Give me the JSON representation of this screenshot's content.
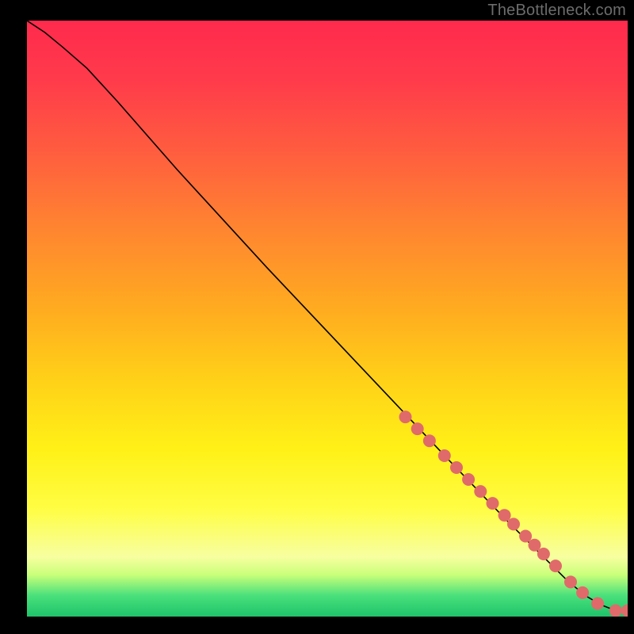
{
  "attribution": "TheBottleneck.com",
  "chart_data": {
    "type": "line",
    "title": "",
    "xlabel": "",
    "ylabel": "",
    "xlim": [
      0,
      100
    ],
    "ylim": [
      0,
      100
    ],
    "background_gradient": {
      "type": "vertical",
      "stops": [
        {
          "pos": 0.0,
          "color": "#ff2a4d"
        },
        {
          "pos": 0.5,
          "color": "#ffbf1a"
        },
        {
          "pos": 0.8,
          "color": "#fffb30"
        },
        {
          "pos": 0.96,
          "color": "#49e07c"
        },
        {
          "pos": 1.0,
          "color": "#1fc36a"
        }
      ]
    },
    "series": [
      {
        "name": "curve",
        "style": "line",
        "color": "#000000",
        "width": 1.6,
        "x": [
          0.0,
          3.0,
          6.0,
          10.0,
          15.0,
          25.0,
          40.0,
          55.0,
          70.0,
          80.0,
          86.0,
          90.0,
          93.0,
          95.5,
          97.0,
          98.5,
          100.0
        ],
        "y": [
          100.0,
          98.0,
          95.5,
          92.0,
          86.5,
          75.0,
          58.5,
          42.5,
          26.5,
          16.0,
          10.0,
          6.0,
          3.5,
          2.0,
          1.4,
          1.0,
          1.0
        ]
      },
      {
        "name": "points",
        "style": "marker",
        "color": "#e06a6a",
        "radius": 8,
        "x": [
          63.0,
          65.0,
          67.0,
          69.5,
          71.5,
          73.5,
          75.5,
          77.5,
          79.5,
          81.0,
          83.0,
          84.5,
          86.0,
          88.0,
          90.5,
          92.5,
          95.0,
          98.0,
          100.0
        ],
        "y": [
          33.5,
          31.5,
          29.5,
          27.0,
          25.0,
          23.0,
          21.0,
          19.0,
          17.0,
          15.5,
          13.5,
          12.0,
          10.5,
          8.5,
          5.8,
          4.0,
          2.2,
          1.0,
          1.0
        ]
      }
    ]
  }
}
